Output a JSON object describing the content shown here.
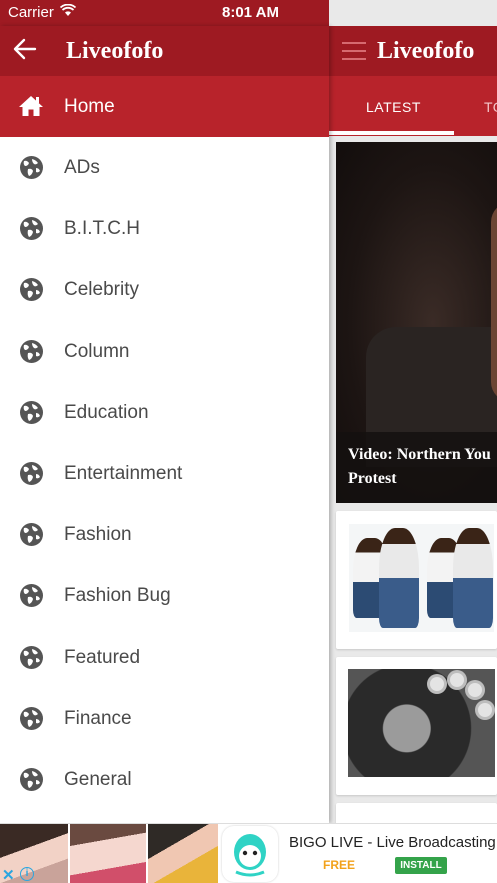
{
  "status_bar": {
    "carrier": "Carrier",
    "time": "8:01 AM"
  },
  "app": {
    "title": "Liveofofo"
  },
  "drawer": {
    "title": "Liveofofo",
    "home_label": "Home",
    "items": [
      {
        "label": "ADs"
      },
      {
        "label": "B.I.T.C.H"
      },
      {
        "label": "Celebrity"
      },
      {
        "label": "Column"
      },
      {
        "label": "Education"
      },
      {
        "label": "Entertainment"
      },
      {
        "label": "Fashion"
      },
      {
        "label": "Fashion Bug"
      },
      {
        "label": "Featured"
      },
      {
        "label": "Finance"
      },
      {
        "label": "General"
      }
    ]
  },
  "tabs": {
    "latest": "LATEST",
    "top": "TO"
  },
  "hero": {
    "caption": "Video: Northern You Protest"
  },
  "ad": {
    "title": "BIGO LIVE - Live Broadcasting",
    "free": "FREE",
    "install": "INSTALL"
  },
  "colors": {
    "primary": "#9e1a22",
    "accent": "#b8232b",
    "ad_free": "#f2a21b",
    "ad_install": "#34a34a"
  }
}
